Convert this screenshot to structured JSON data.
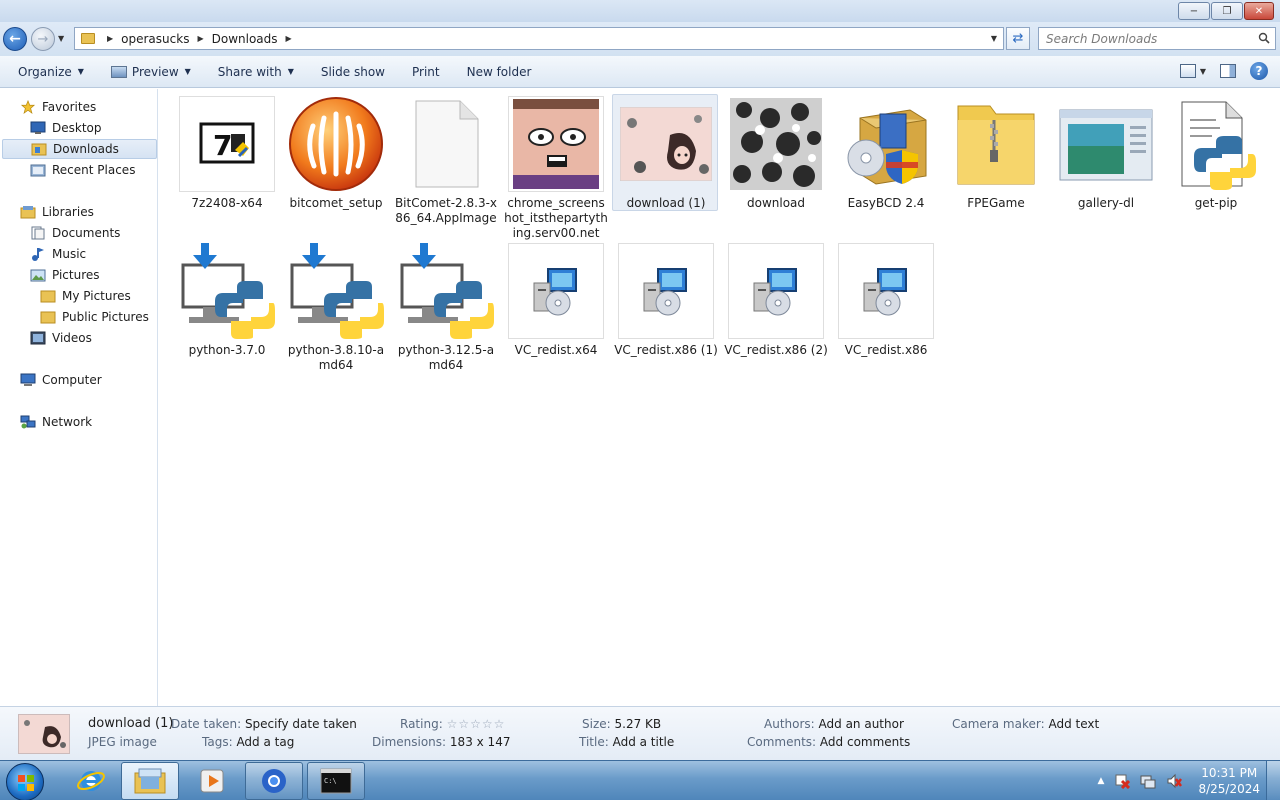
{
  "window": {
    "minimize": "−",
    "maximize": "❐",
    "close": "✕"
  },
  "address": {
    "crumbs": [
      "operasucks",
      "Downloads"
    ],
    "search_placeholder": "Search Downloads"
  },
  "toolbar": {
    "organize": "Organize",
    "preview": "Preview",
    "share_with": "Share with",
    "slide_show": "Slide show",
    "print": "Print",
    "new_folder": "New folder",
    "help": "?"
  },
  "nav": {
    "favorites": "Favorites",
    "desktop": "Desktop",
    "downloads": "Downloads",
    "recent_places": "Recent Places",
    "libraries": "Libraries",
    "documents": "Documents",
    "music": "Music",
    "pictures": "Pictures",
    "my_pictures": "My Pictures",
    "public_pictures": "Public Pictures",
    "videos": "Videos",
    "computer": "Computer",
    "network": "Network"
  },
  "files": [
    {
      "name": "7z2408-x64",
      "icon": "7zip-installer-icon"
    },
    {
      "name": "bitcomet_setup",
      "icon": "bitcomet-icon"
    },
    {
      "name": "BitComet-2.8.3-x86_64.AppImage",
      "icon": "blank-file-icon"
    },
    {
      "name": "chrome_screenshot_itsthepartything.serv00.net",
      "icon": "image-thumbnail"
    },
    {
      "name": "download (1)",
      "icon": "image-thumbnail"
    },
    {
      "name": "download",
      "icon": "image-thumbnail"
    },
    {
      "name": "EasyBCD 2.4",
      "icon": "easybcd-installer-icon"
    },
    {
      "name": "FPEGame",
      "icon": "zip-folder-icon"
    },
    {
      "name": "gallery-dl",
      "icon": "gallery-dl-window-icon"
    },
    {
      "name": "get-pip",
      "icon": "python-script-icon"
    },
    {
      "name": "python-3.7.0",
      "icon": "python-installer-icon"
    },
    {
      "name": "python-3.8.10-amd64",
      "icon": "python-installer-icon"
    },
    {
      "name": "python-3.12.5-amd64",
      "icon": "python-installer-icon"
    },
    {
      "name": "VC_redist.x64",
      "icon": "msi-installer-icon"
    },
    {
      "name": "VC_redist.x86 (1)",
      "icon": "msi-installer-icon"
    },
    {
      "name": "VC_redist.x86 (2)",
      "icon": "msi-installer-icon"
    },
    {
      "name": "VC_redist.x86",
      "icon": "msi-installer-icon"
    }
  ],
  "details": {
    "name": "download (1)",
    "type": "JPEG image",
    "date_taken_label": "Date taken:",
    "date_taken_value": "Specify date taken",
    "tags_label": "Tags:",
    "tags_value": "Add a tag",
    "rating_label": "Rating:",
    "rating_stars": "☆☆☆☆☆",
    "rating_value": 0,
    "dimensions_label": "Dimensions:",
    "dimensions_value": "183 x 147",
    "size_label": "Size:",
    "size_value": "5.27 KB",
    "title_label": "Title:",
    "title_value": "Add a title",
    "authors_label": "Authors:",
    "authors_value": "Add an author",
    "comments_label": "Comments:",
    "comments_value": "Add comments",
    "camera_label": "Camera maker:",
    "camera_value": "Add text"
  },
  "taskbar": {
    "time": "10:31 PM",
    "date": "8/25/2024",
    "tray_arrow": "▲"
  },
  "colors": {
    "accent": "#1e5eb7",
    "selection": "#d6e3f3"
  }
}
